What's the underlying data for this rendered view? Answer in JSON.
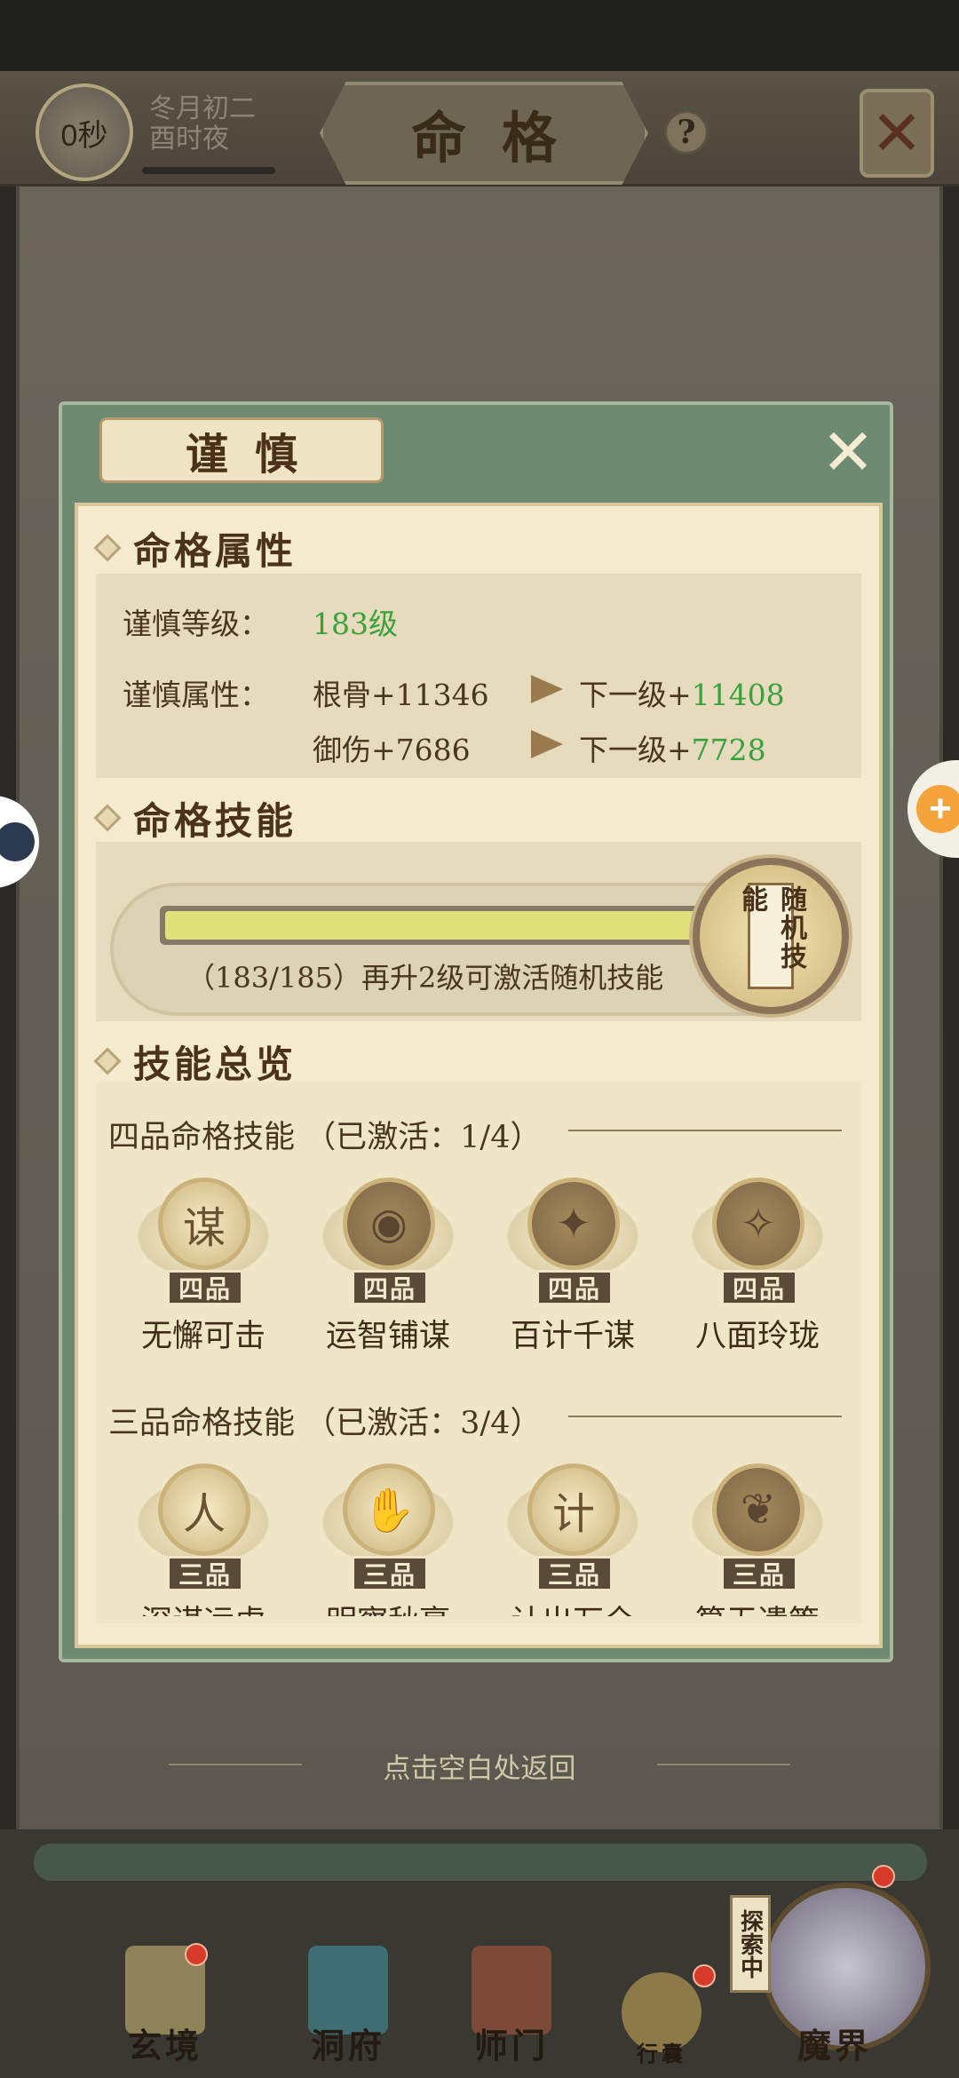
{
  "header": {
    "timer": "0秒",
    "date_line1": "冬月初二",
    "date_line2": "酉时夜",
    "title": "命格",
    "help_icon": "?",
    "close_icon": "✕"
  },
  "dialog": {
    "title": "谨慎",
    "close_icon": "✕",
    "attributes": {
      "section_title": "命格属性",
      "level_label": "谨慎等级：",
      "level_value": "183级",
      "attr_label": "谨慎属性：",
      "rows": [
        {
          "current": "根骨+11346",
          "next_prefix": "下一级+",
          "next_value": "11408"
        },
        {
          "current": "御伤+7686",
          "next_prefix": "下一级+",
          "next_value": "7728"
        }
      ]
    },
    "skill": {
      "section_title": "命格技能",
      "progress_current": 183,
      "progress_max": 185,
      "progress_text": "（183/185）再升2级可激活随机技能",
      "medal_label": "随机技能"
    },
    "overview": {
      "section_title": "技能总览",
      "grades": [
        {
          "label": "四品命格技能",
          "status": "（已激活：1/4）",
          "skills": [
            {
              "name": "无懈可击",
              "badge": "四品",
              "glyph": "谋",
              "active": true
            },
            {
              "name": "运智铺谋",
              "badge": "四品",
              "glyph": "◉",
              "active": false
            },
            {
              "name": "百计千谋",
              "badge": "四品",
              "glyph": "✦",
              "active": false
            },
            {
              "name": "八面玲珑",
              "badge": "四品",
              "glyph": "✧",
              "active": false
            }
          ]
        },
        {
          "label": "三品命格技能",
          "status": "（已激活：3/4）",
          "skills": [
            {
              "name": "深谋远虑",
              "badge": "三品",
              "glyph": "人",
              "active": true
            },
            {
              "name": "明察秋毫",
              "badge": "三品",
              "glyph": "✋",
              "active": true
            },
            {
              "name": "计出万全",
              "badge": "三品",
              "glyph": "计",
              "active": true
            },
            {
              "name": "算无遗策",
              "badge": "三品",
              "glyph": "❦",
              "active": false
            }
          ]
        }
      ]
    }
  },
  "tap_hint": "点击空白处返回",
  "bottom_nav": {
    "items": [
      "玄境",
      "洞府",
      "师门",
      "行囊",
      "魔界"
    ],
    "explore": "探索中"
  },
  "colors": {
    "accent_green": "#3aa13e",
    "panel": "#f4ebcf",
    "frame": "#6e8a73"
  }
}
